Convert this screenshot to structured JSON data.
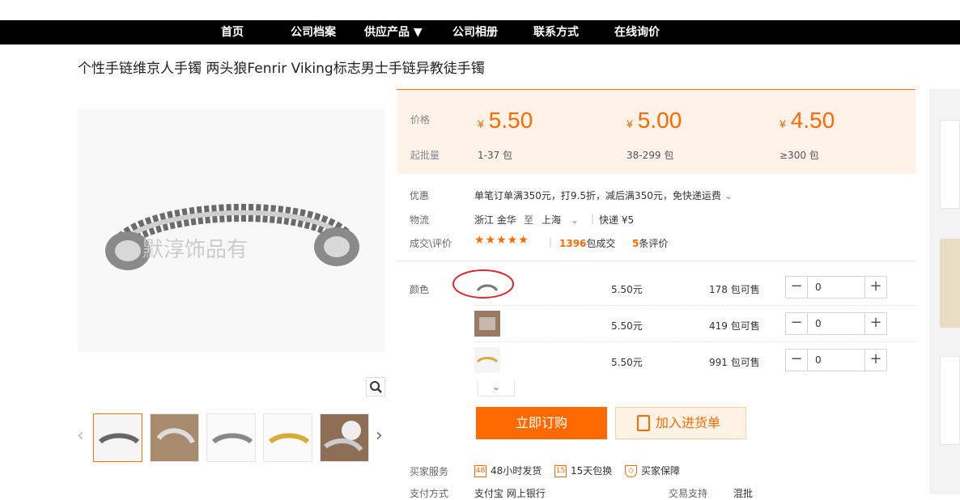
{
  "nav": [
    "首页",
    "公司档案",
    "供应产品 ▼",
    "公司相册",
    "联系方式",
    "在线询价"
  ],
  "product_title": "个性手链维京人手镯 两头狼Fenrir Viking标志男士手链异教徒手镯",
  "watermark": "默淳饰品有",
  "price_panel": {
    "price_label": "价格",
    "moq_label": "起批量",
    "tiers": [
      {
        "currency": "¥",
        "price": "5.50",
        "qty": "1-37 包"
      },
      {
        "currency": "¥",
        "price": "5.00",
        "qty": "38-299 包"
      },
      {
        "currency": "¥",
        "price": "4.50",
        "qty": "≥300 包"
      }
    ]
  },
  "promo": {
    "label": "优惠",
    "text": "单笔订单满350元，打9.5折，减后满350元，免快递运费"
  },
  "logistics": {
    "label": "物流",
    "from": "浙江 金华",
    "to_word": "至",
    "to": "上海",
    "express": "快递 ¥5"
  },
  "deals": {
    "label": "成交\\评价",
    "stars": "★★★★★",
    "sold_num": "1396",
    "sold_unit": "包成交",
    "review_num": "5",
    "review_unit": "条评价"
  },
  "sku": {
    "label": "颜色",
    "rows": [
      {
        "price": "5.50元",
        "stock": "178 包可售",
        "qty": "0"
      },
      {
        "price": "5.50元",
        "stock": "419 包可售",
        "qty": "0"
      },
      {
        "price": "5.50元",
        "stock": "991 包可售",
        "qty": "0"
      }
    ]
  },
  "buttons": {
    "order": "立即订购",
    "cart": "加入进货单"
  },
  "services": {
    "label": "买家服务",
    "items": [
      {
        "icon": "48",
        "text": "48小时发货"
      },
      {
        "icon": "15",
        "text": "15天包换"
      },
      {
        "icon": "◇",
        "text": "买家保障"
      }
    ]
  },
  "bottom_row": {
    "pay_label": "支付方式",
    "pay_value": "支付宝 网上银行",
    "trade_label": "交易支持",
    "trade_value": "混批"
  },
  "colors": {
    "accent": "#ff6a00",
    "nav_bg": "#000000",
    "price_bg": "#fff2e8",
    "annotation": "#e0262b"
  }
}
